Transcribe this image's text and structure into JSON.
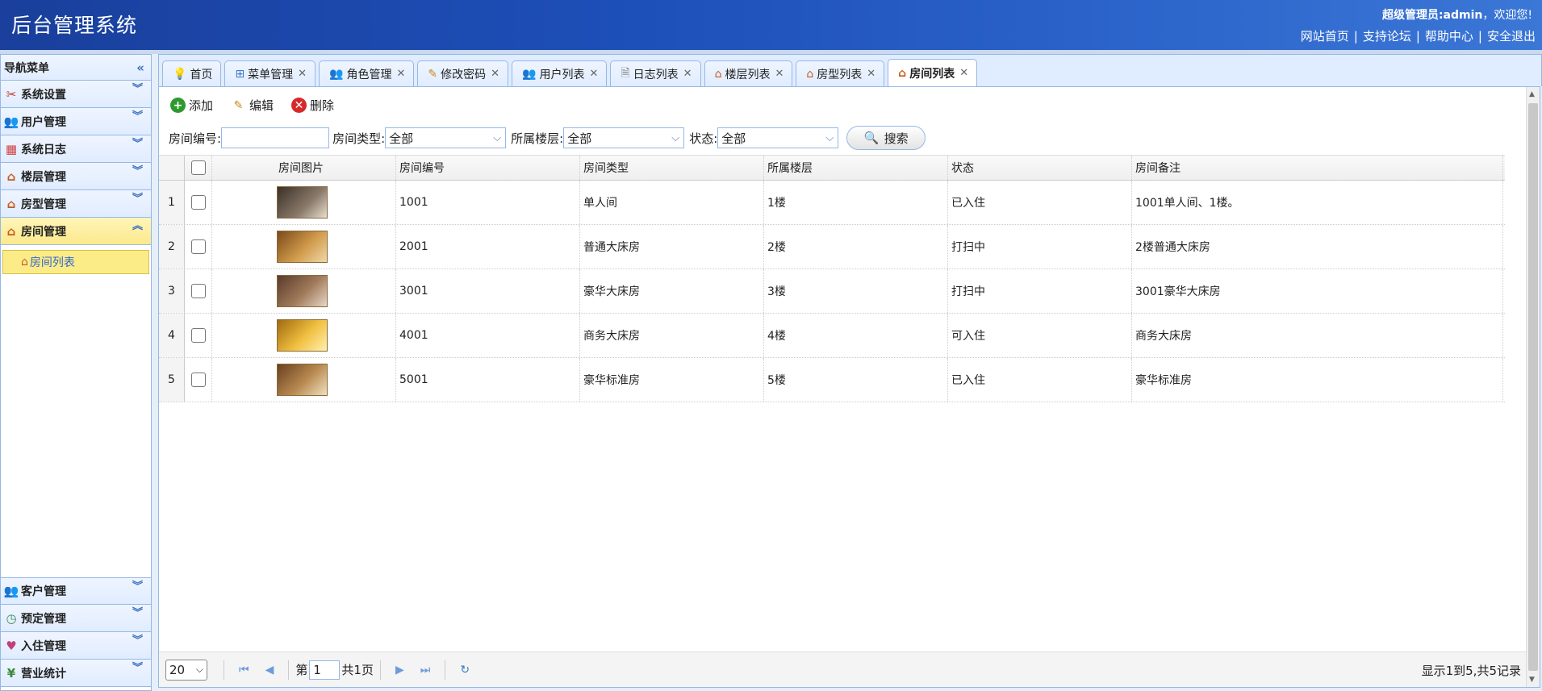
{
  "header": {
    "title": "后台管理系统",
    "welcome_user": "超级管理员:admin",
    "welcome_suffix": "，欢迎您!",
    "links": [
      "网站首页",
      "支持论坛",
      "帮助中心",
      "安全退出"
    ]
  },
  "sidebar": {
    "title": "导航菜单",
    "groups": [
      {
        "label": "系统设置",
        "icon": "tools-icon"
      },
      {
        "label": "用户管理",
        "icon": "users-icon"
      },
      {
        "label": "系统日志",
        "icon": "log-icon"
      },
      {
        "label": "楼层管理",
        "icon": "house-icon"
      },
      {
        "label": "房型管理",
        "icon": "house-icon"
      },
      {
        "label": "房间管理",
        "icon": "house-icon",
        "active": true
      }
    ],
    "submenu_item": "房间列表",
    "bottom_groups": [
      {
        "label": "客户管理",
        "icon": "users-icon"
      },
      {
        "label": "预定管理",
        "icon": "clock-icon"
      },
      {
        "label": "入住管理",
        "icon": "heart-icon"
      },
      {
        "label": "营业统计",
        "icon": "yen-icon"
      }
    ]
  },
  "tabs": [
    {
      "label": "首页",
      "icon": "bulb-icon",
      "closable": false
    },
    {
      "label": "菜单管理",
      "icon": "tree-icon",
      "closable": true
    },
    {
      "label": "角色管理",
      "icon": "users-icon",
      "closable": true
    },
    {
      "label": "修改密码",
      "icon": "edit-icon",
      "closable": true
    },
    {
      "label": "用户列表",
      "icon": "users-icon",
      "closable": true
    },
    {
      "label": "日志列表",
      "icon": "document-icon",
      "closable": true
    },
    {
      "label": "楼层列表",
      "icon": "house-icon",
      "closable": true
    },
    {
      "label": "房型列表",
      "icon": "house-icon",
      "closable": true
    },
    {
      "label": "房间列表",
      "icon": "house-icon",
      "closable": true,
      "active": true
    }
  ],
  "toolbar": {
    "add": "添加",
    "edit": "编辑",
    "delete": "删除"
  },
  "search": {
    "room_no_label": "房间编号:",
    "room_no_value": "",
    "room_type_label": "房间类型:",
    "room_type_value": "全部",
    "floor_label": "所属楼层:",
    "floor_value": "全部",
    "status_label": "状态:",
    "status_value": "全部",
    "search_button": "搜索"
  },
  "grid": {
    "columns": [
      "房间图片",
      "房间编号",
      "房间类型",
      "所属楼层",
      "状态",
      "房间备注"
    ],
    "rows": [
      {
        "num": "1",
        "room_no": "1001",
        "type": "单人间",
        "floor": "1楼",
        "status": "已入住",
        "note": "1001单人间、1楼。",
        "img_color": "#6b5a4a"
      },
      {
        "num": "2",
        "room_no": "2001",
        "type": "普通大床房",
        "floor": "2楼",
        "status": "打扫中",
        "note": "2楼普通大床房",
        "img_color": "#b07a3a"
      },
      {
        "num": "3",
        "room_no": "3001",
        "type": "豪华大床房",
        "floor": "3楼",
        "status": "打扫中",
        "note": "3001豪华大床房",
        "img_color": "#8a6a4a"
      },
      {
        "num": "4",
        "room_no": "4001",
        "type": "商务大床房",
        "floor": "4楼",
        "status": "可入住",
        "note": "商务大床房",
        "img_color": "#d6a22a"
      },
      {
        "num": "5",
        "room_no": "5001",
        "type": "豪华标准房",
        "floor": "5楼",
        "status": "已入住",
        "note": "豪华标准房",
        "img_color": "#9a6a3a"
      }
    ]
  },
  "pager": {
    "page_size": "20",
    "page_prefix": "第",
    "page_value": "1",
    "page_total": "共1页",
    "info": "显示1到5,共5记录"
  },
  "colors": {
    "header_start": "#1a3f9c",
    "header_end": "#3b77d6",
    "border": "#95b8e7",
    "active_menu": "#fbec88"
  }
}
